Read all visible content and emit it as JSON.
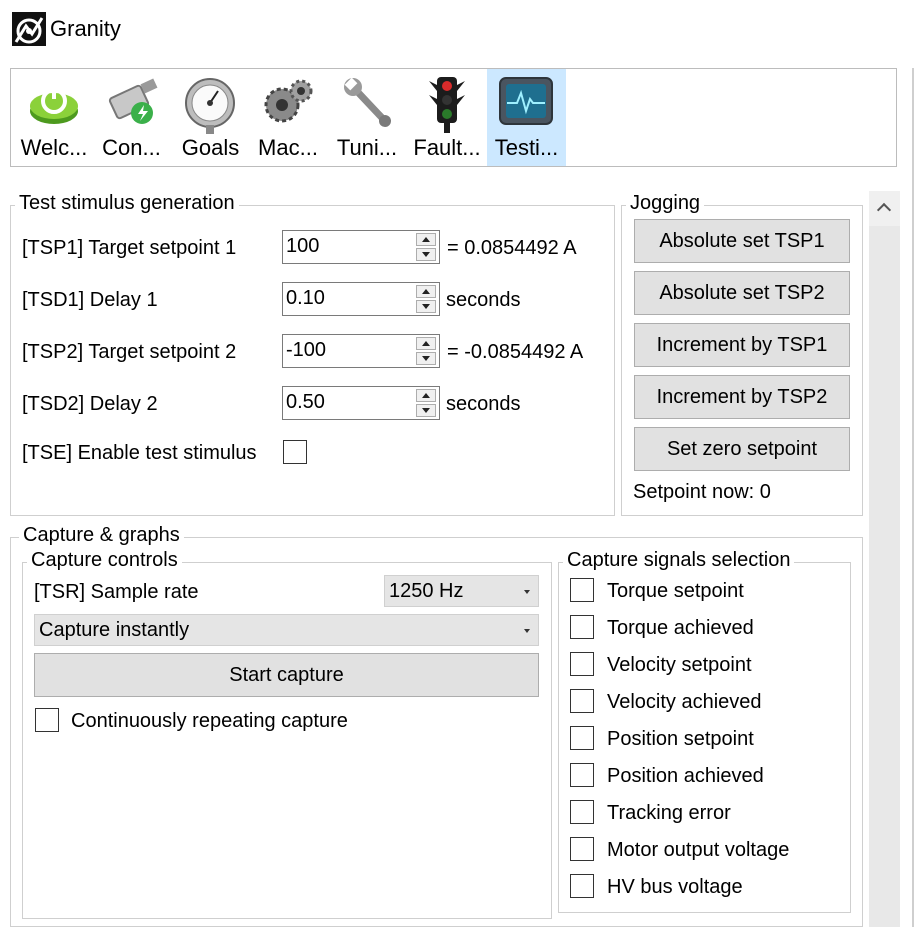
{
  "window": {
    "title": "Granity"
  },
  "toolbar": {
    "items": [
      {
        "label": "Welc...",
        "icon": "power-icon"
      },
      {
        "label": "Con...",
        "icon": "network-plug-icon"
      },
      {
        "label": "Goals",
        "icon": "pressure-gauge-icon"
      },
      {
        "label": "Mac...",
        "icon": "gears-icon"
      },
      {
        "label": "Tuni...",
        "icon": "wrench-icon"
      },
      {
        "label": "Fault...",
        "icon": "traffic-light-icon"
      },
      {
        "label": "Testi...",
        "icon": "monitor-waveform-icon",
        "active": true
      }
    ]
  },
  "stimulus": {
    "title": "Test stimulus generation",
    "tsp1": {
      "label": "[TSP1] Target setpoint 1",
      "value": "100",
      "suffix": "= 0.0854492 A"
    },
    "tsd1": {
      "label": "[TSD1] Delay 1",
      "value": "0.10",
      "suffix": "seconds"
    },
    "tsp2": {
      "label": "[TSP2] Target setpoint 2",
      "value": "-100",
      "suffix": "= -0.0854492 A"
    },
    "tsd2": {
      "label": "[TSD2] Delay 2",
      "value": "0.50",
      "suffix": "seconds"
    },
    "tse": {
      "label": "[TSE] Enable test stimulus",
      "checked": false
    }
  },
  "jogging": {
    "title": "Jogging",
    "buttons": [
      "Absolute set TSP1",
      "Absolute set TSP2",
      "Increment by TSP1",
      "Increment by TSP2",
      "Set zero setpoint"
    ],
    "status": "Setpoint now: 0"
  },
  "capture": {
    "title": "Capture & graphs",
    "controls": {
      "title": "Capture controls",
      "sample_rate_label": "[TSR] Sample rate",
      "sample_rate_value": "1250 Hz",
      "trigger_mode": "Capture instantly",
      "start_button": "Start capture",
      "repeat_label": "Continuously repeating capture",
      "repeat_checked": false
    },
    "signals": {
      "title": "Capture signals selection",
      "items": [
        "Torque setpoint",
        "Torque achieved",
        "Velocity setpoint",
        "Velocity achieved",
        "Position setpoint",
        "Position achieved",
        "Tracking error",
        "Motor output voltage",
        "HV bus voltage"
      ]
    }
  },
  "colors": {
    "selected_tab": "#cce8ff",
    "button_face": "#e1e1e1",
    "group_border": "#cfcfcf"
  }
}
